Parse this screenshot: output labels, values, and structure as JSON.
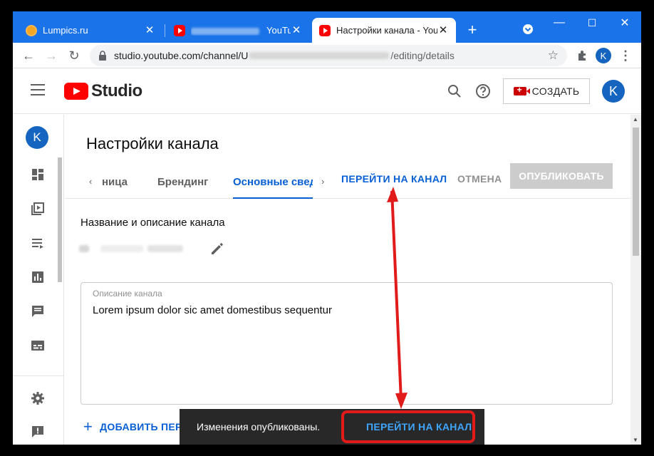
{
  "browser": {
    "tabs": [
      {
        "title": "Lumpics.ru",
        "active": false
      },
      {
        "title": "YouTu",
        "active": false
      },
      {
        "title": "Настройки канала - YouTu",
        "active": true
      }
    ],
    "new_tab": "+",
    "url_host": "studio.youtube.com/channel/U",
    "url_path": "/editing/details",
    "profile_initial": "K"
  },
  "studio": {
    "logo_text": "Studio",
    "create_label": "СОЗДАТЬ",
    "avatar_initial": "K"
  },
  "sidebar": {
    "avatar_initial": "K",
    "items": [
      {
        "icon": "dashboard-icon"
      },
      {
        "icon": "content-icon"
      },
      {
        "icon": "playlists-icon"
      },
      {
        "icon": "analytics-icon"
      },
      {
        "icon": "comments-icon"
      },
      {
        "icon": "subtitles-icon"
      },
      {
        "icon": "settings-icon"
      },
      {
        "icon": "feedback-icon"
      }
    ]
  },
  "main": {
    "page_title": "Настройки канала",
    "tabs": [
      {
        "label": "ница",
        "active": false
      },
      {
        "label": "Брендинг",
        "active": false
      },
      {
        "label": "Основные сведе",
        "active": true
      }
    ],
    "goto_channel": "ПЕРЕЙТИ НА КАНАЛ",
    "cancel": "ОТМЕНА",
    "publish": "ОПУБЛИКОВАТЬ",
    "section_title": "Название и описание канала",
    "description_label": "Описание канала",
    "description_value": "Lorem ipsum dolor sic amet domestibus sequentur",
    "add_link": "ДОБАВИТЬ ПЕРЕВОД"
  },
  "snackbar": {
    "message": "Изменения опубликованы.",
    "action": "ПЕРЕЙТИ НА КАНАЛ"
  },
  "colors": {
    "chrome_blue": "#1a73e8",
    "studio_blue": "#065fd4",
    "annotation_red": "#e11a1a"
  }
}
